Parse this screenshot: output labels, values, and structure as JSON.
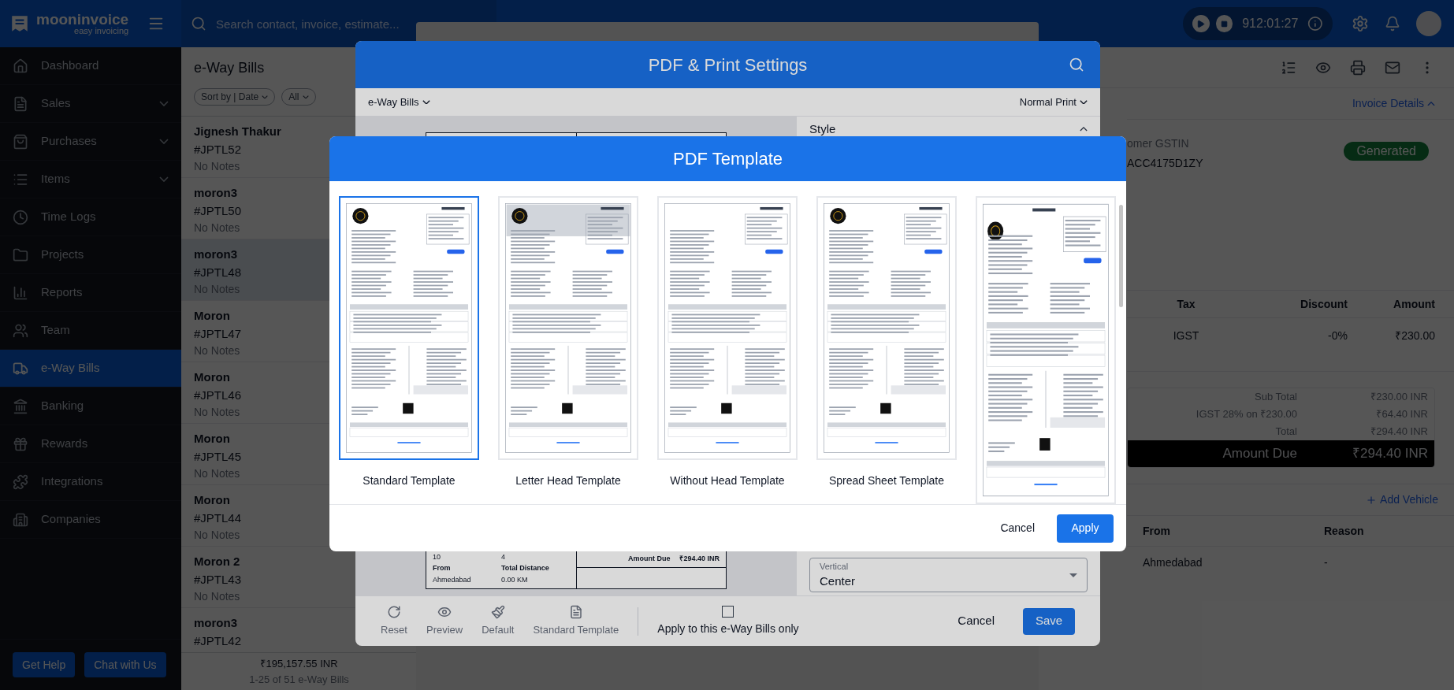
{
  "header": {
    "logo": {
      "name": "mooninvoice",
      "tagline": "easy invoicing"
    },
    "search": {
      "placeholder": "Search contact, invoice, estimate..."
    },
    "timer": "912:01:27"
  },
  "sidebar": {
    "items": [
      {
        "label": "Dashboard",
        "expandable": false,
        "selected": false
      },
      {
        "label": "Sales",
        "expandable": true,
        "selected": false
      },
      {
        "label": "Purchases",
        "expandable": true,
        "selected": false
      },
      {
        "label": "Items",
        "expandable": true,
        "selected": false
      },
      {
        "label": "Time Logs",
        "expandable": false,
        "selected": false
      },
      {
        "label": "Projects",
        "expandable": false,
        "selected": false
      },
      {
        "label": "Reports",
        "expandable": false,
        "selected": false
      },
      {
        "label": "Team",
        "expandable": false,
        "selected": false
      },
      {
        "label": "e-Way Bills",
        "expandable": false,
        "selected": true
      },
      {
        "label": "Banking",
        "expandable": false,
        "selected": false
      },
      {
        "label": "Rewards",
        "expandable": false,
        "selected": false
      },
      {
        "label": "Integrations",
        "expandable": false,
        "selected": false
      },
      {
        "label": "Companies",
        "expandable": false,
        "selected": false
      }
    ],
    "buttons": [
      "Get Help",
      "Chat with Us"
    ]
  },
  "list": {
    "title": "e-Way Bills",
    "filters": [
      "Sort by | Date",
      "All"
    ],
    "rows": [
      {
        "name": "Jignesh Thakur",
        "number": "#JPTL52",
        "notes": "No Notes",
        "selected": false
      },
      {
        "name": "moron3",
        "number": "#JPTL50",
        "notes": "No Notes",
        "selected": false
      },
      {
        "name": "moron3",
        "number": "#JPTL48",
        "notes": "No Notes",
        "selected": true
      },
      {
        "name": "Moron",
        "number": "#JPTL47",
        "notes": "No Notes",
        "selected": false
      },
      {
        "name": "Moron",
        "number": "#JPTL46",
        "notes": "No Notes",
        "selected": false
      },
      {
        "name": "Moron",
        "number": "#JPTL45",
        "notes": "No Notes",
        "selected": false
      },
      {
        "name": "Moron",
        "number": "#JPTL44",
        "notes": "No Notes",
        "selected": false
      },
      {
        "name": "Moron 2",
        "number": "#JPTL43",
        "notes": "No Notes",
        "selected": false
      },
      {
        "name": "moron3",
        "number": "#JPTL42",
        "selected": false
      }
    ],
    "footer": {
      "total": "₹195,157.55 INR",
      "range": "1-25 of 51 e-Way Bills"
    }
  },
  "detail": {
    "link": "Invoice Details",
    "gstin_label": "omer GSTIN",
    "gstin": "ACC4175D1ZY",
    "status": "Generated",
    "items_table": {
      "columns": [
        "Tax",
        "Discount",
        "Amount"
      ],
      "rows": [
        [
          "IGST",
          "-0%",
          "₹230.00"
        ]
      ]
    },
    "totals": [
      {
        "label": "Sub Total",
        "value": "₹230.00 INR"
      },
      {
        "label": "IGST 28% on ₹230.00",
        "value": "₹64.40 INR"
      },
      {
        "label": "Total",
        "value": "₹294.40 INR"
      }
    ],
    "amount_due": {
      "label": "Amount Due",
      "value": "₹294.40 INR"
    },
    "add_vehicle": "Add Vehicle",
    "vehicles": {
      "columns": [
        "From",
        "Reason"
      ],
      "rows": [
        [
          "Ahmedabad",
          "-"
        ]
      ]
    }
  },
  "settings_dialog": {
    "title": "PDF & Print Settings",
    "document_type": "e-Way Bills",
    "print_mode": "Normal Print",
    "panel": {
      "section": "Style",
      "select": {
        "label": "Vertical",
        "value": "Center"
      }
    },
    "preview": {
      "left_rows": [
        [
          "10",
          "4"
        ],
        [
          "From",
          "Total Distance"
        ],
        [
          "Ahmedabad",
          "0.00 KM"
        ]
      ],
      "due_label": "Amount Due",
      "due_value": "₹294.40 INR"
    },
    "footer": {
      "tools": [
        "Reset",
        "Preview",
        "Default",
        "Standard Template"
      ],
      "apply_only": {
        "label": "Apply to this e-Way Bills only",
        "checked": false
      },
      "cancel": "Cancel",
      "save": "Save"
    }
  },
  "template_dialog": {
    "title": "PDF Template",
    "templates": [
      {
        "label": "Standard Template",
        "kind": "standard",
        "selected": true
      },
      {
        "label": "Letter Head Template",
        "kind": "letterhead",
        "selected": false
      },
      {
        "label": "Without Head Template",
        "kind": "plain",
        "selected": false
      },
      {
        "label": "Spread Sheet Template",
        "kind": "spreadsheet",
        "selected": false
      },
      {
        "kind": "columns",
        "selected": false
      }
    ],
    "cancel": "Cancel",
    "apply": "Apply"
  }
}
